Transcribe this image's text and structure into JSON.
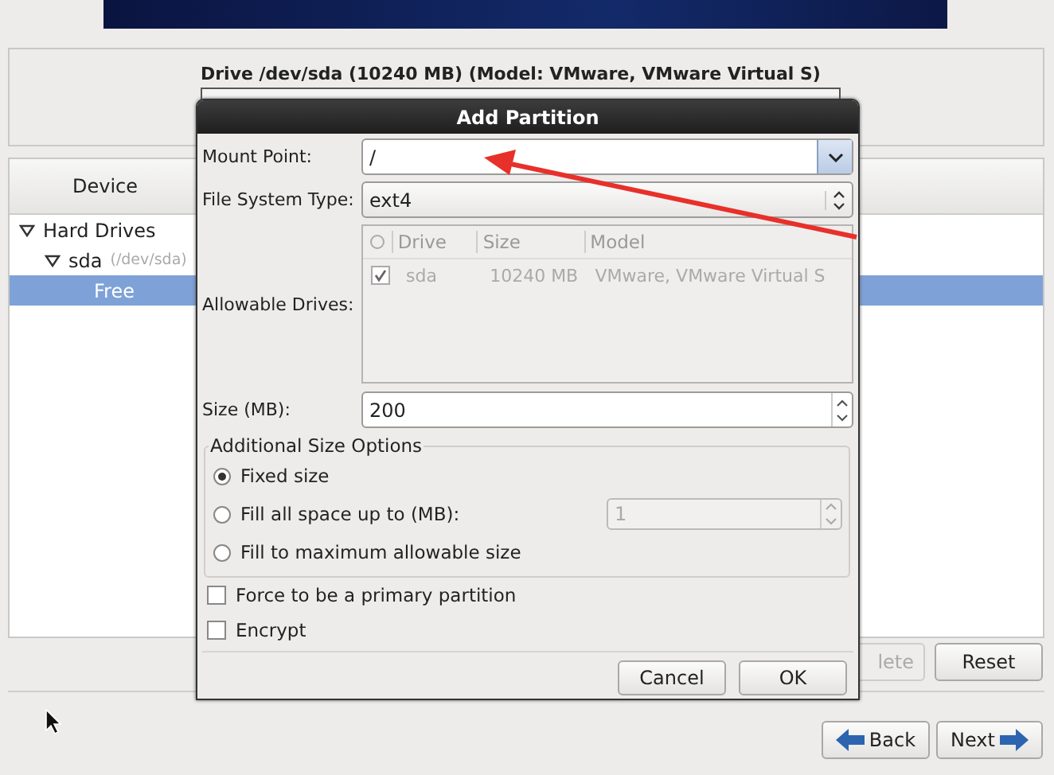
{
  "drive": {
    "title": "Drive /dev/sda (10240 MB) (Model: VMware, VMware Virtual S)"
  },
  "device_tree": {
    "header": "Device",
    "items": [
      {
        "label": "Hard Drives",
        "expanded": true,
        "selected": false,
        "children": [
          {
            "label": "sda",
            "detail": "(/dev/sda)",
            "expanded": true,
            "selected": false,
            "children": [
              {
                "label": "Free",
                "selected": true
              }
            ]
          }
        ]
      }
    ]
  },
  "device_buttons": [
    {
      "label": "lete",
      "disabled": true
    },
    {
      "label": "Reset",
      "disabled": false
    }
  ],
  "nav_buttons": [
    {
      "label": "Back",
      "kind": "back"
    },
    {
      "label": "Next",
      "kind": "next"
    }
  ],
  "dialog": {
    "title": "Add Partition",
    "mount_point": {
      "label": "Mount Point:",
      "value": "/"
    },
    "file_system_type": {
      "label": "File System Type:",
      "value": "ext4"
    },
    "allowable_drives": {
      "label": "Allowable Drives:",
      "disabled": true,
      "columns": [
        "Drive",
        "Size",
        "Model"
      ],
      "rows": [
        {
          "checked": true,
          "cells": [
            "sda",
            "10240 MB",
            "VMware, VMware Virtual S"
          ]
        }
      ]
    },
    "size": {
      "label": "Size (MB):",
      "value": "200"
    },
    "size_options": {
      "title": "Additional Size Options",
      "options": [
        {
          "label": "Fixed size",
          "selected": true
        },
        {
          "label": "Fill all space up to (MB):",
          "selected": false,
          "field_value": "1",
          "field_disabled": true
        },
        {
          "label": "Fill to maximum allowable size",
          "selected": false
        }
      ]
    },
    "checkboxes": [
      {
        "label": "Force to be a primary partition",
        "checked": false
      },
      {
        "label": "Encrypt",
        "checked": false
      }
    ],
    "buttons": [
      "Cancel",
      "OK"
    ]
  }
}
